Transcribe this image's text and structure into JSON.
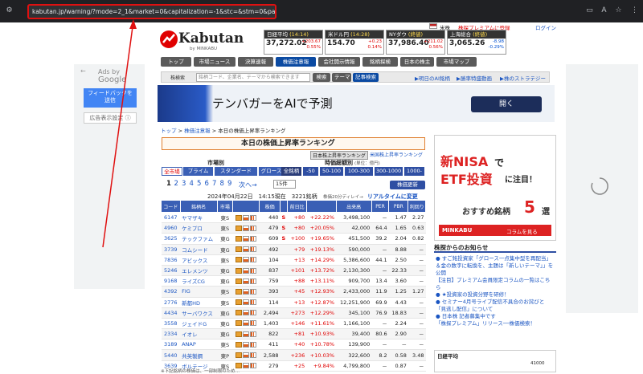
{
  "browser": {
    "url": "kabutan.jp/warning/?mode=2_1&market=0&capitalization=-1&stc=&stm=0&page=1"
  },
  "ads": {
    "ads_by": "Ads by",
    "google": "Google",
    "feedback": "フィードバックを送信",
    "settings": "広告表示設定 ⓘ"
  },
  "header": {
    "logo": "Kabutan",
    "logo_sub": "by MINKABU",
    "flag_label": "米株",
    "premium": "株探プレミアムに登録",
    "login": "ログイン"
  },
  "markets": [
    {
      "name": "日経平均",
      "time": "(14:14)",
      "value": "37,272.02",
      "diff": "+203.67",
      "pct": "0.55%",
      "dir": "pos"
    },
    {
      "name": "米ドル円",
      "time": "(14:28)",
      "value": "154.70",
      "diff": "+0.23",
      "pct": "0.14%",
      "dir": "pos"
    },
    {
      "name": "NYダウ",
      "time": "(終値)",
      "value": "37,986.40",
      "diff": "+211.02",
      "pct": "0.56%",
      "dir": "pos"
    },
    {
      "name": "上海総合",
      "time": "(終値)",
      "value": "3,065.26",
      "diff": "-8.98",
      "pct": "-0.29%",
      "dir": "neg"
    }
  ],
  "nav": [
    "トップ",
    "市場ニュース",
    "決算速報",
    "株価注意報",
    "会社開示情報",
    "銘柄探検",
    "日本の株主",
    "市場マップ"
  ],
  "search": {
    "label": "株検索",
    "placeholder": "銘柄コード、企業名、テーマから検索できます",
    "btn1": "検索",
    "btn2": "テーマ",
    "btn3": "記事検索"
  },
  "toplinks": [
    "▶明日のAI銘柄",
    "▶勝率特盛動画",
    "▶株のストラテジー"
  ],
  "banner": {
    "text": "テンバガーをAIで予測",
    "button": "開く"
  },
  "breadcrumb": [
    "トップ",
    ">",
    "株価注意報",
    ">",
    "本日の株価上昇率ランキング"
  ],
  "title": "本日の株価上昇率ランキング",
  "subtabs": [
    "日本株上昇率ランキング",
    "米国株上昇率ランキング"
  ],
  "market_label": "市場別",
  "cap_label": "時価総額別",
  "cap_unit": "(単位：億円)",
  "market_tabs": [
    "全市場",
    "プライム",
    "スタンダード",
    "グロース"
  ],
  "cap_tabs": [
    "全銘柄",
    "-50",
    "50-100",
    "100-300",
    "300-1000",
    "1000-"
  ],
  "pagination": {
    "pages": [
      "1",
      "2",
      "3",
      "4",
      "5",
      "6",
      "7",
      "8",
      "9"
    ],
    "next": "次へ→",
    "select": "15件",
    "update": "株価更新"
  },
  "datetime": "2024年04月22日　14:15現在　3221銘柄",
  "delay": "株価20分ディレイ→",
  "realtime": "リアルタイムに変更",
  "table": {
    "headers": [
      "コード",
      "銘柄名",
      "市場",
      "",
      "株価",
      "",
      "前日比",
      "",
      "出来高",
      "PER",
      "PBR",
      "利回り"
    ],
    "rows": [
      [
        "6147",
        "ヤマザキ",
        "東S",
        "440",
        "S",
        "+80",
        "+22.22%",
        "3,498,100",
        "－",
        "1.47",
        "2.27"
      ],
      [
        "4960",
        "ケミプロ",
        "東S",
        "479",
        "S",
        "+80",
        "+20.05%",
        "42,000",
        "64.4",
        "1.65",
        "0.63"
      ],
      [
        "3625",
        "テックファム",
        "東G",
        "609",
        "S",
        "+100",
        "+19.65%",
        "451,500",
        "39.2",
        "2.04",
        "0.82"
      ],
      [
        "3739",
        "コムシード",
        "東G",
        "492",
        "",
        "+79",
        "+19.13%",
        "590,000",
        "－",
        "8.88",
        "－"
      ],
      [
        "7836",
        "アビックス",
        "東S",
        "104",
        "",
        "+13",
        "+14.29%",
        "5,386,600",
        "44.1",
        "2.50",
        "－"
      ],
      [
        "5246",
        "エレメンツ",
        "東G",
        "837",
        "",
        "+101",
        "+13.72%",
        "2,130,300",
        "－",
        "22.33",
        "－"
      ],
      [
        "9168",
        "ライズCG",
        "東G",
        "759",
        "",
        "+88",
        "+13.11%",
        "909,700",
        "13.4",
        "3.60",
        "－"
      ],
      [
        "4392",
        "FIG",
        "東S",
        "393",
        "",
        "+45",
        "+12.93%",
        "2,433,000",
        "11.9",
        "1.25",
        "1.27"
      ],
      [
        "2776",
        "新都HD",
        "東S",
        "114",
        "",
        "+13",
        "+12.87%",
        "12,251,900",
        "69.9",
        "4.43",
        "－"
      ],
      [
        "4434",
        "サーバワクス",
        "東G",
        "2,494",
        "",
        "+273",
        "+12.29%",
        "345,100",
        "76.9",
        "18.83",
        "－"
      ],
      [
        "3558",
        "ジェイドG",
        "東G",
        "1,403",
        "",
        "+146",
        "+11.61%",
        "1,166,100",
        "－",
        "2.24",
        "－"
      ],
      [
        "2334",
        "イオレ",
        "東G",
        "822",
        "",
        "+81",
        "+10.93%",
        "39,400",
        "80.6",
        "2.90",
        "－"
      ],
      [
        "3189",
        "ANAP",
        "東S",
        "411",
        "",
        "+40",
        "+10.78%",
        "139,900",
        "－",
        "－",
        "－"
      ],
      [
        "5440",
        "共英製鋼",
        "東P",
        "2,588",
        "",
        "+236",
        "+10.03%",
        "322,600",
        "8.2",
        "0.58",
        "3.48"
      ],
      [
        "3639",
        "ボルテージ",
        "東S",
        "279",
        "",
        "+25",
        "+9.84%",
        "4,799,800",
        "－",
        "0.87",
        "－"
      ]
    ]
  },
  "footnote": "※下記銘柄の株価は、一部制限のため…",
  "side_ad": {
    "title1": "新NISA",
    "title2": "で",
    "title3": "ETF投資",
    "title4": "に注目！",
    "sub": "おすすめ銘柄",
    "num": "5",
    "sub2": "選",
    "brand": "MINKABU",
    "cta": "コラムを見る"
  },
  "notice": {
    "heading": "株探からのお知らせ",
    "items": [
      "● すご銘投資家「グロース一点集中型を再配当」＆金の数字に転換を、主題は「新しいテーマ」」を公開",
      "【注目】プレミアム会員限定コラムの一覧はこちら",
      "● ★投資家の投資分野を研修！",
      "● セミナー4月号ライブ配信不具合のお詫びと「見逃し配信」について",
      "● 日本株 記者募集中です",
      "「株探プレミアム」リリース──株価検索！"
    ]
  },
  "mini_chart": {
    "title": "日経平均",
    "value": "41000"
  }
}
